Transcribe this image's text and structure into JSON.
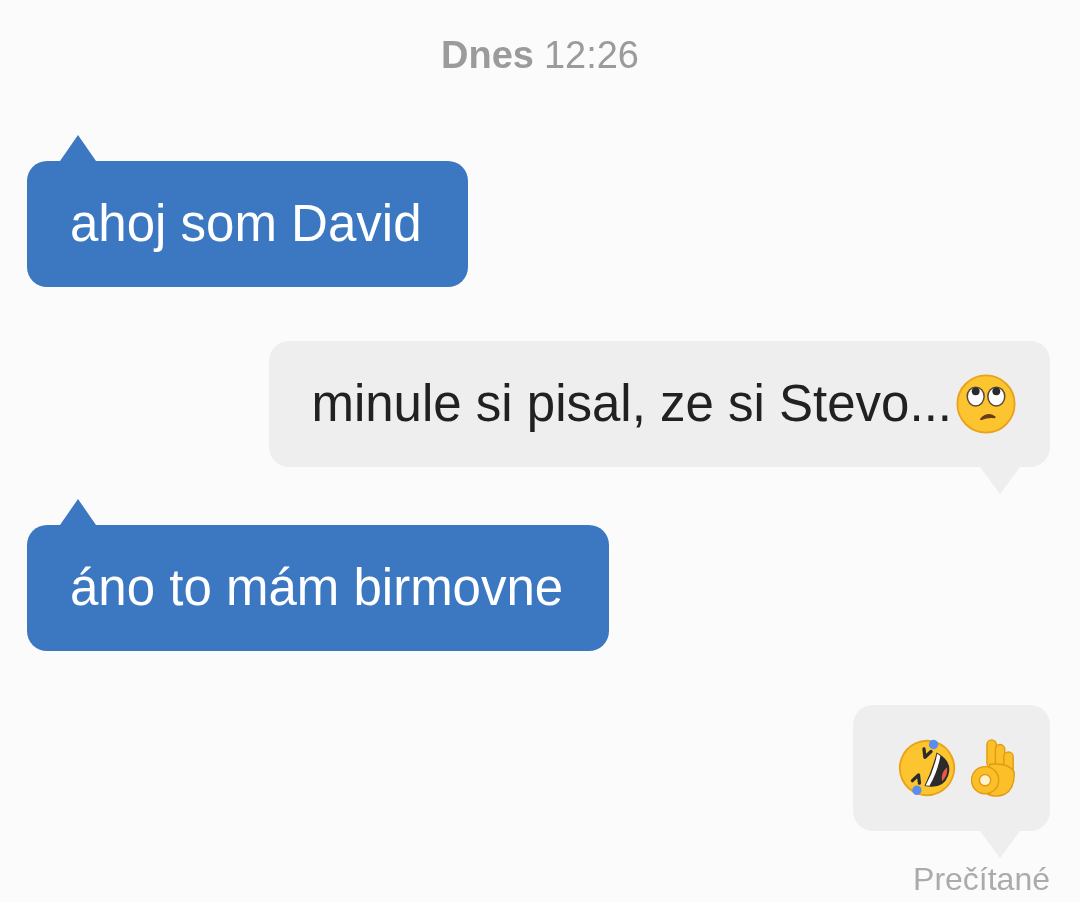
{
  "date_divider": {
    "day": "Dnes",
    "time": "12:26"
  },
  "messages": [
    {
      "kind": "received",
      "text": "ahoj som David"
    },
    {
      "kind": "sent",
      "text": "minule si pisal, ze si Stevo...",
      "emojis": [
        {
          "kind": "face_with_rolling_eyes"
        }
      ]
    },
    {
      "kind": "received",
      "text": "áno to mám birmovne"
    },
    {
      "kind": "sent",
      "emojis": [
        {
          "kind": "rolling_on_floor_laughing"
        },
        {
          "kind": "ok_hand"
        }
      ]
    }
  ],
  "read_receipt": "Prečítané"
}
